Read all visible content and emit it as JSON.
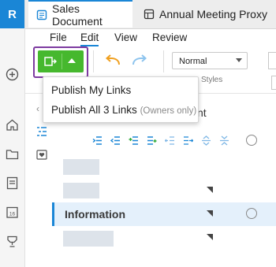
{
  "app": {
    "logo_letter": "R",
    "accent": "#1a86d6",
    "publish_green": "#46b82e",
    "highlight_outline": "#7d3aa0"
  },
  "tabs": [
    {
      "label": "Sales Document",
      "active": true,
      "icon": "document-icon"
    },
    {
      "label": "Annual Meeting Proxy",
      "active": false,
      "icon": "table-icon"
    }
  ],
  "menu": [
    "File",
    "Edit",
    "View",
    "Review"
  ],
  "toolbar": {
    "publish_icon": "publish-link-icon",
    "undo_icon": "undo-arrow-icon",
    "redo_icon": "redo-arrow-icon",
    "style_value": "Normal",
    "styles_label": "Styles"
  },
  "dropdown": {
    "items": [
      {
        "label": "Publish My Links",
        "note": ""
      },
      {
        "label": "Publish All 3 Links",
        "note": "(Owners only)"
      }
    ]
  },
  "outline": {
    "title_fragment": "nt",
    "selected_row": "Information"
  },
  "rail_icons": [
    "add-circle-icon",
    "home-icon",
    "folder-icon",
    "document-list-icon",
    "calendar-icon",
    "trophy-icon"
  ]
}
